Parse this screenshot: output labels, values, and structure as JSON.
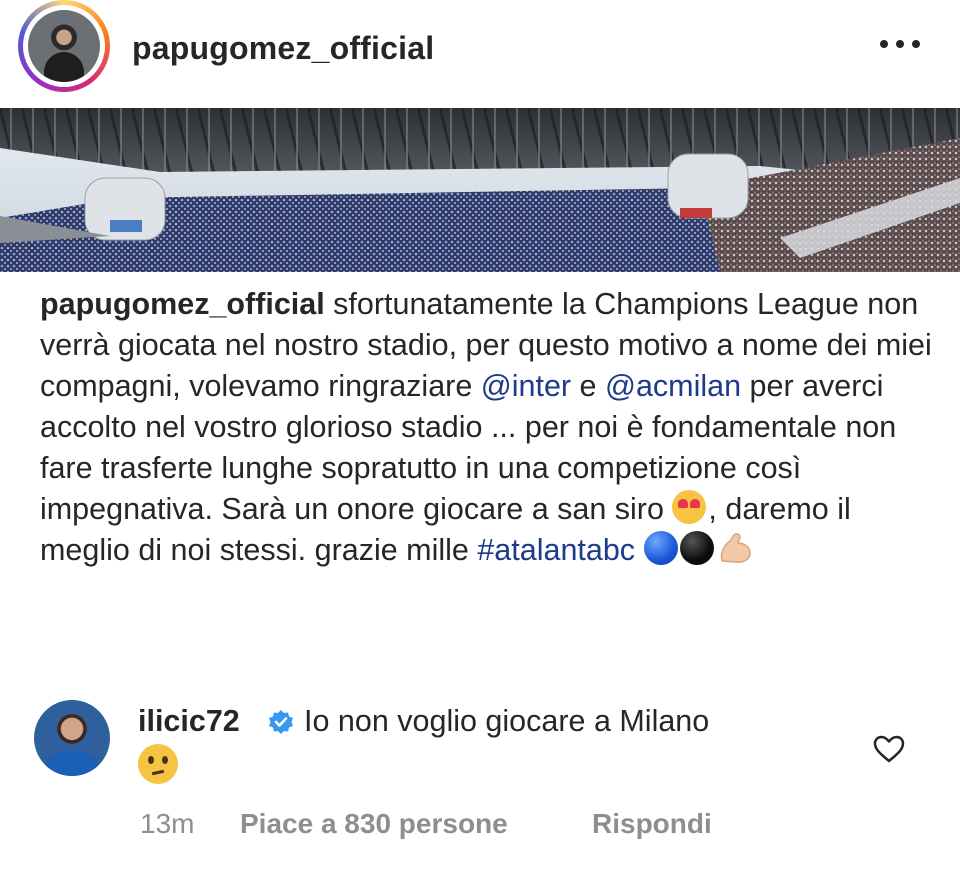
{
  "post": {
    "username": "papugomez_official",
    "more_icon": "more-horizontal-icon"
  },
  "caption": {
    "username": "papugomez_official",
    "text_1": " sfortunatamente la Champions League non verrà giocata nel nostro stadio, per questo motivo a nome dei miei compagni, volevamo ringraziare ",
    "mention_1": "@inter",
    "text_2": " e ",
    "mention_2": "@acmilan",
    "text_3": " per averci accolto nel vostro glorioso stadio ... per noi è fondamentale non fare trasferte lunghe sopratutto in una competizione così impegnativa. Sarà un onore giocare a san siro ",
    "text_4": ", daremo il meglio di noi stessi. grazie mille ",
    "hashtag": "#atalantabc",
    "emojis": [
      "heart-eyes",
      "blue-circle",
      "black-circle",
      "flexed-biceps"
    ]
  },
  "comment": {
    "username": "ilicic72",
    "verified": true,
    "text": "Io non voglio giocare a Milano",
    "emoji": "thinking-face",
    "time": "13m",
    "likes": "Piace a 830 persone",
    "reply": "Rispondi"
  },
  "colors": {
    "text": "#262626",
    "link": "#1e3a8a",
    "meta": "#8e8e8e"
  }
}
